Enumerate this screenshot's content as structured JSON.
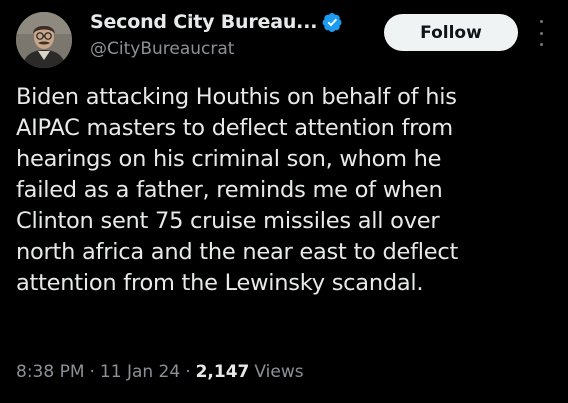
{
  "author": {
    "display_name": "Second City Bureau...",
    "handle": "@CityBureaucrat",
    "verified": true,
    "verified_color": "#1d9bf0"
  },
  "actions": {
    "follow_label": "Follow",
    "more_icon": "more-vertical-icon"
  },
  "tweet": {
    "text": "Biden attacking Houthis on behalf of his\nAIPAC masters to deflect attention from\nhearings on his criminal son, whom he\nfailed as a father, reminds me of when\nClinton sent 75 cruise missiles all over\nnorth africa and the near east to deflect\nattention from the Lewinsky scandal."
  },
  "meta": {
    "time": "8:38 PM",
    "separator": "·",
    "date": "11 Jan 24",
    "views_count": "2,147",
    "views_label": "Views"
  },
  "colors": {
    "background": "#000000",
    "text_primary": "#e7e9ea",
    "text_secondary": "#8b9197",
    "follow_bg": "#eff3f4",
    "follow_text": "#0f1419"
  }
}
